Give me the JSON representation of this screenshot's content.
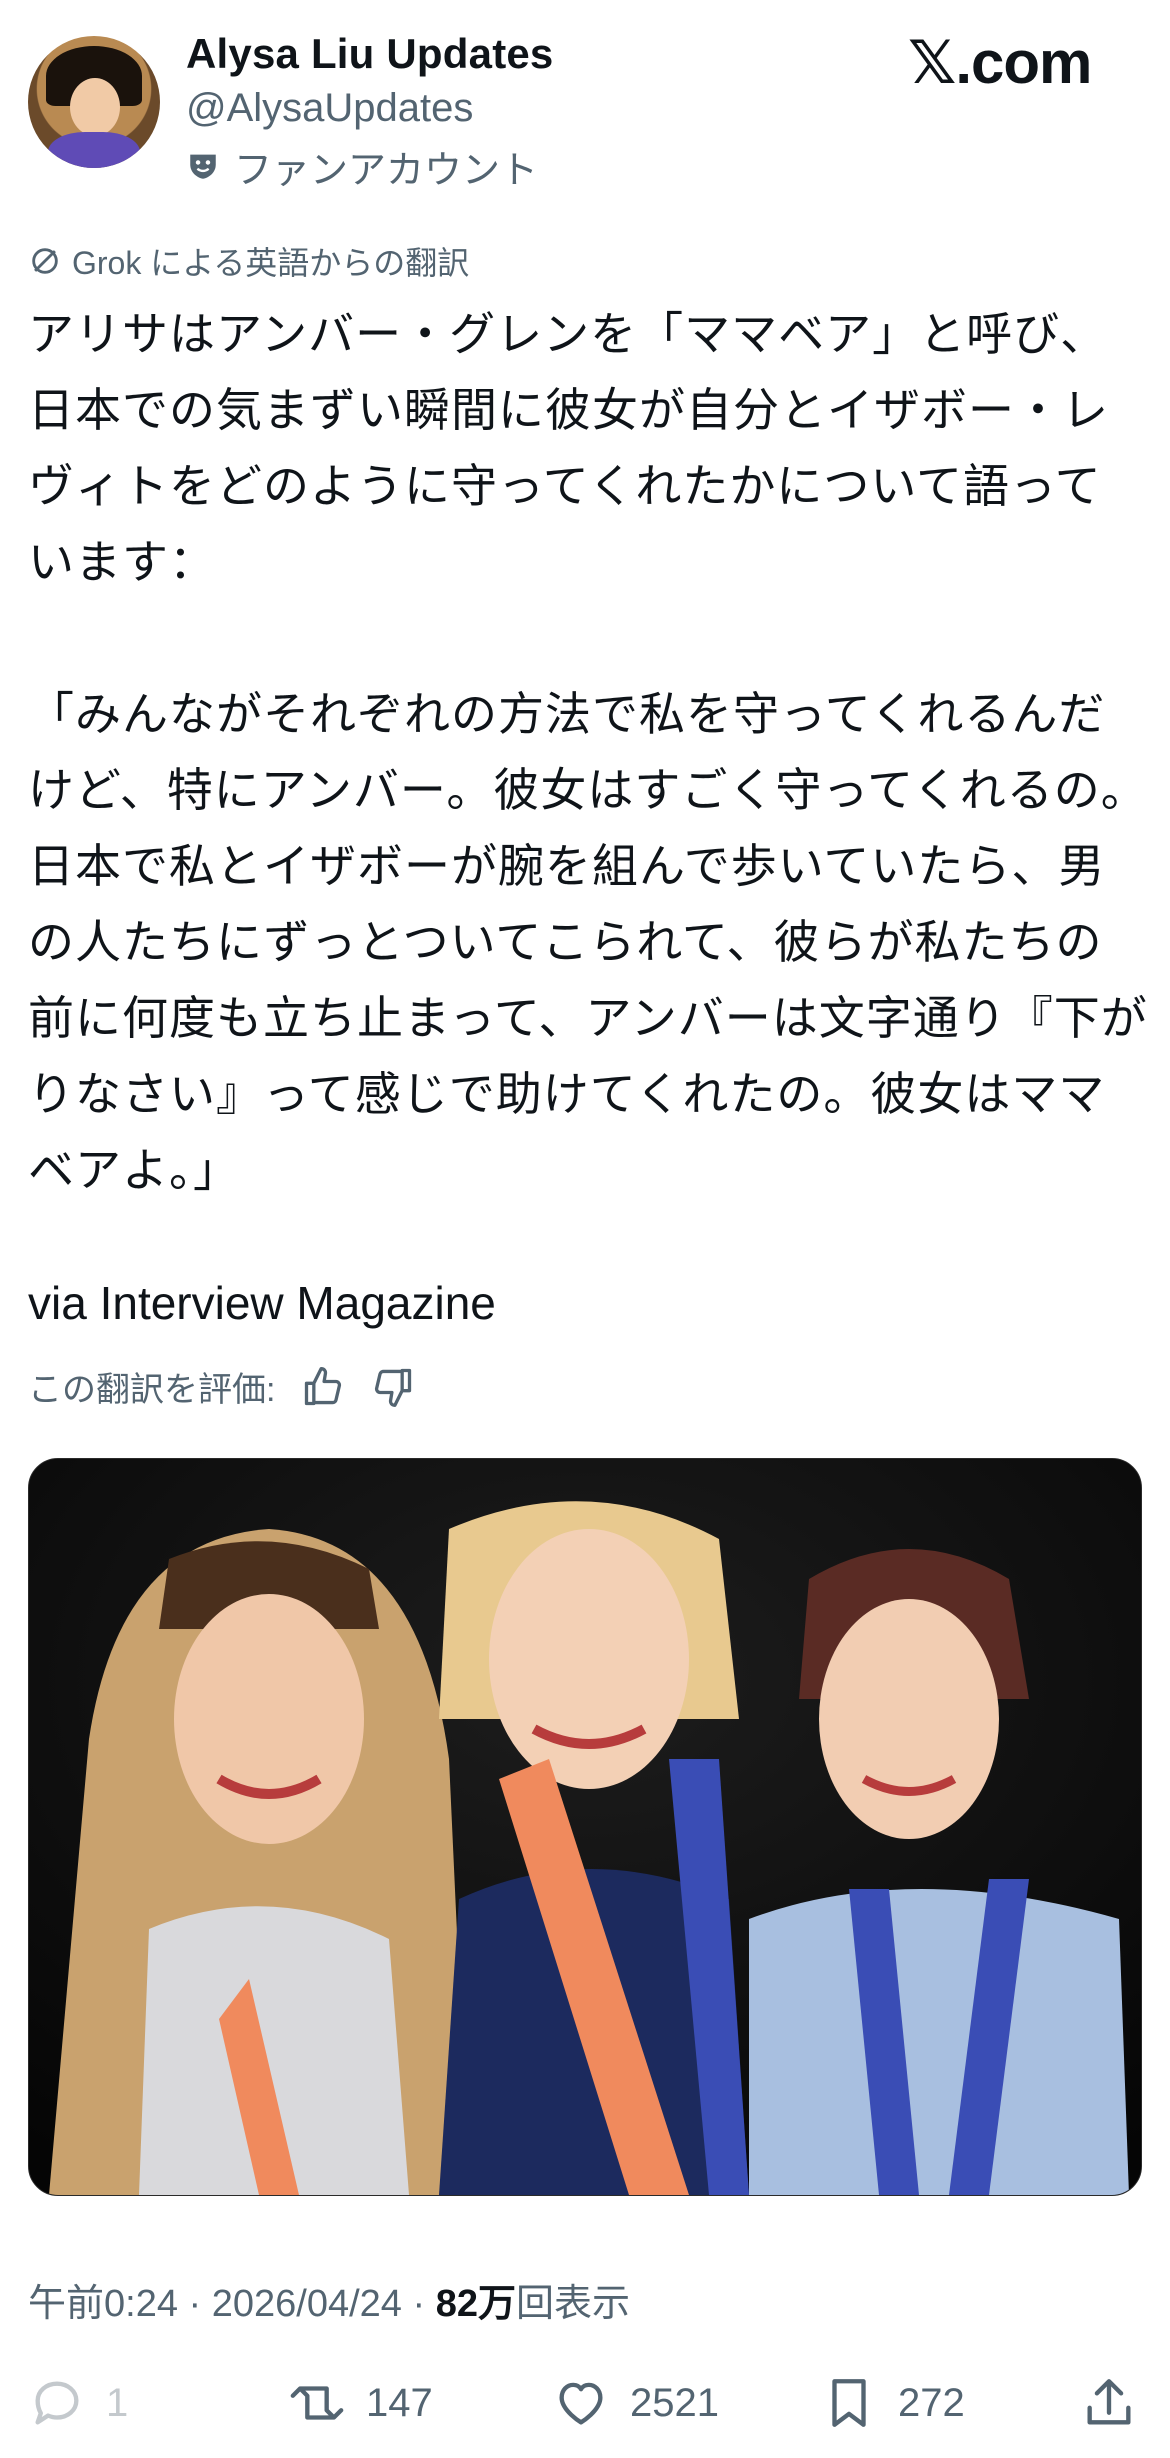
{
  "header": {
    "name": "Alysa Liu Updates",
    "handle": "@AlysaUpdates",
    "badge_label": "ファンアカウント",
    "badge_icon": "mask-icon",
    "site_logo": "𝕏.com"
  },
  "translation": {
    "label": "Grok による英語からの翻訳",
    "icon": "translate-icon"
  },
  "post": {
    "text": "アリサはアンバー・グレンを「ママベア」と呼び、日本での気まずい瞬間に彼女が自分とイザボー・レヴィトをどのように守ってくれたかについて語っています：\n\n「みんながそれぞれの方法で私を守ってくれるんだけど、特にアンバー。彼女はすごく守ってくれるの。日本で私とイザボーが腕を組んで歩いていたら、男の人たちにずっとついてこられて、彼らが私たちの前に何度も立ち止まって、アンバーは文字通り『下がりなさい』って感じで助けてくれたの。彼女はママベアよ。」",
    "via": "via Interview Magazine"
  },
  "rating": {
    "label": "この翻訳を評価:"
  },
  "meta": {
    "time": "午前0:24 · 2026/04/24 · ",
    "views": "82万",
    "views_label": "回表示"
  },
  "actions": {
    "reply": "1",
    "retweet": "147",
    "like": "2521",
    "bookmark": "272"
  },
  "colors": {
    "text": "#0f1419",
    "secondary": "#536471",
    "medal_ribbon_orange": "#f08a5d",
    "medal_ribbon_blue": "#3a4db5"
  }
}
